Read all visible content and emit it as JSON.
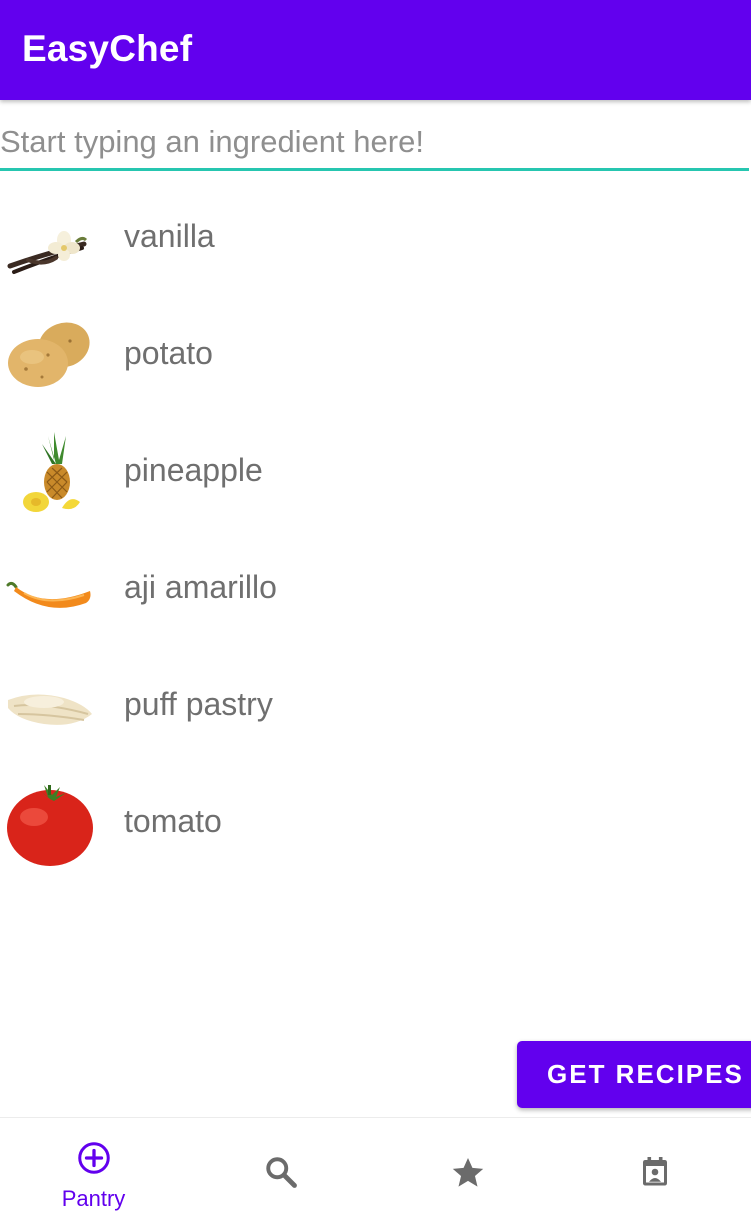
{
  "app": {
    "title": "EasyChef"
  },
  "search": {
    "placeholder": "Start typing an ingredient here!",
    "value": ""
  },
  "ingredients": [
    {
      "name": "vanilla",
      "icon": "vanilla-icon"
    },
    {
      "name": "potato",
      "icon": "potato-icon"
    },
    {
      "name": "pineapple",
      "icon": "pineapple-icon"
    },
    {
      "name": "aji amarillo",
      "icon": "pepper-icon"
    },
    {
      "name": "puff pastry",
      "icon": "pastry-icon"
    },
    {
      "name": "tomato",
      "icon": "tomato-icon"
    }
  ],
  "actions": {
    "get_recipes_label": "GET RECIPES"
  },
  "nav": {
    "items": [
      {
        "label": "Pantry",
        "icon": "add-circle-icon",
        "active": true
      },
      {
        "label": "",
        "icon": "search-icon",
        "active": false
      },
      {
        "label": "",
        "icon": "star-icon",
        "active": false
      },
      {
        "label": "",
        "icon": "calendar-icon",
        "active": false
      }
    ]
  },
  "colors": {
    "primary": "#6200ee",
    "accent": "#26c6b0",
    "text": "#6f6f6f",
    "icon_inactive": "#6b6b6b"
  }
}
